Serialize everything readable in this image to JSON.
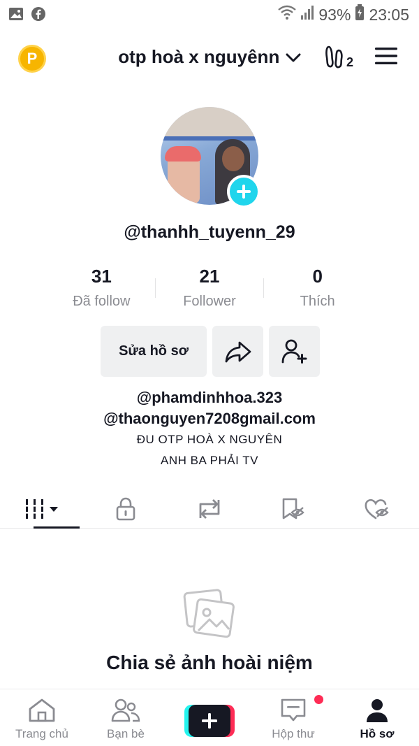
{
  "status_bar": {
    "battery": "93%",
    "time": "23:05",
    "left_icons": [
      "image-icon",
      "facebook-icon"
    ],
    "right_icons": [
      "wifi-icon",
      "signal-icon",
      "battery-icon"
    ]
  },
  "header": {
    "title": "otp hoà x nguyênn",
    "coin_letter": "P",
    "icons": [
      "coin-icon",
      "chevron-down-icon",
      "footprint-icon",
      "menu-icon"
    ],
    "visitor_count": "2"
  },
  "profile": {
    "username": "@thanhh_tuyenn_29",
    "stats": [
      {
        "value": "31",
        "label": "Đã follow"
      },
      {
        "value": "21",
        "label": "Follower"
      },
      {
        "value": "0",
        "label": "Thích"
      }
    ],
    "edit_button": "Sửa hồ sơ",
    "bio": [
      "@phamdinhhoa.323",
      "@thaonguyen7208gmail.com",
      "ĐU OTP HOÀ X NGUYÊN",
      "ANH BA PHẢI TV"
    ]
  },
  "tabs": [
    "videos-grid-icon",
    "lock-icon",
    "repost-icon",
    "hidden-bookmark-icon",
    "hidden-like-icon"
  ],
  "empty_state": {
    "text": "Chia sẻ ảnh hoài niệm"
  },
  "bottom_nav": {
    "items": [
      {
        "label": "Trang chủ",
        "icon": "home-icon"
      },
      {
        "label": "Bạn bè",
        "icon": "friends-icon"
      },
      {
        "label": "",
        "icon": "create-plus-icon"
      },
      {
        "label": "Hộp thư",
        "icon": "inbox-icon"
      },
      {
        "label": "Hồ sơ",
        "icon": "profile-icon"
      }
    ]
  },
  "colors": {
    "accent_cyan": "#20d5ec",
    "accent_red": "#fe2c55",
    "text_primary": "#161823",
    "text_secondary": "#8a8b91",
    "button_bg": "#eff0f1",
    "coin": "#f7b500"
  }
}
